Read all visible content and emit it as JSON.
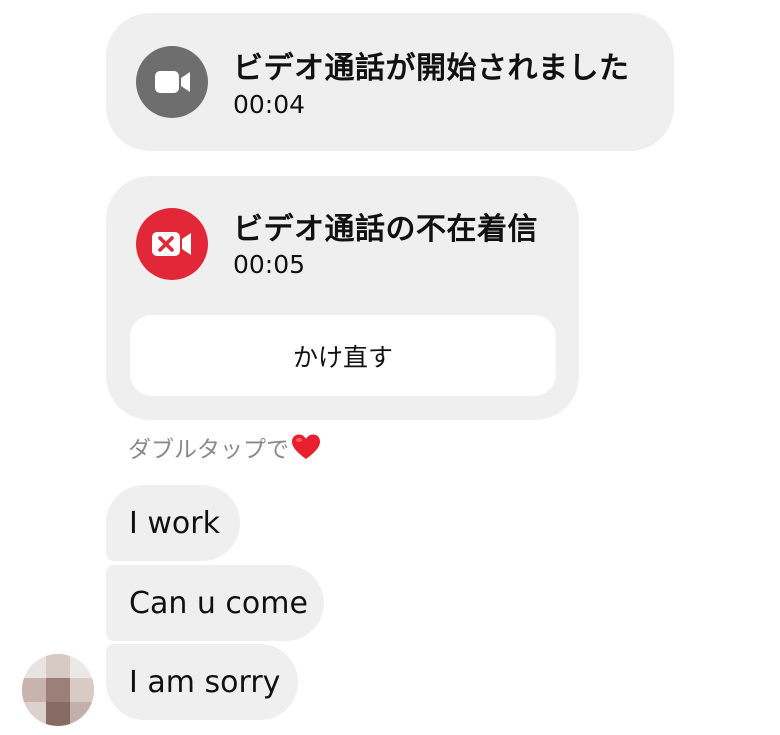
{
  "calls": [
    {
      "title": "ビデオ通話が開始されました",
      "time": "00:04",
      "status": "started",
      "icon": "video-camera-icon",
      "icon_color": "#6e6e6e"
    },
    {
      "title": "ビデオ通話の不在着信",
      "time": "00:05",
      "status": "missed",
      "icon": "missed-video-call-icon",
      "icon_color": "#e22739",
      "callback_label": "かけ直す"
    }
  ],
  "double_tap_hint": {
    "text": "ダブルタップで",
    "emoji": "heart-emoji",
    "emoji_color": "#e8202e"
  },
  "messages": [
    {
      "text": "I work"
    },
    {
      "text": "Can u come"
    },
    {
      "text": "I am sorry"
    }
  ],
  "sender": {
    "avatar": "blurred-avatar"
  },
  "colors": {
    "bubble": "#efefef",
    "hint_text": "#8a8a8a"
  }
}
